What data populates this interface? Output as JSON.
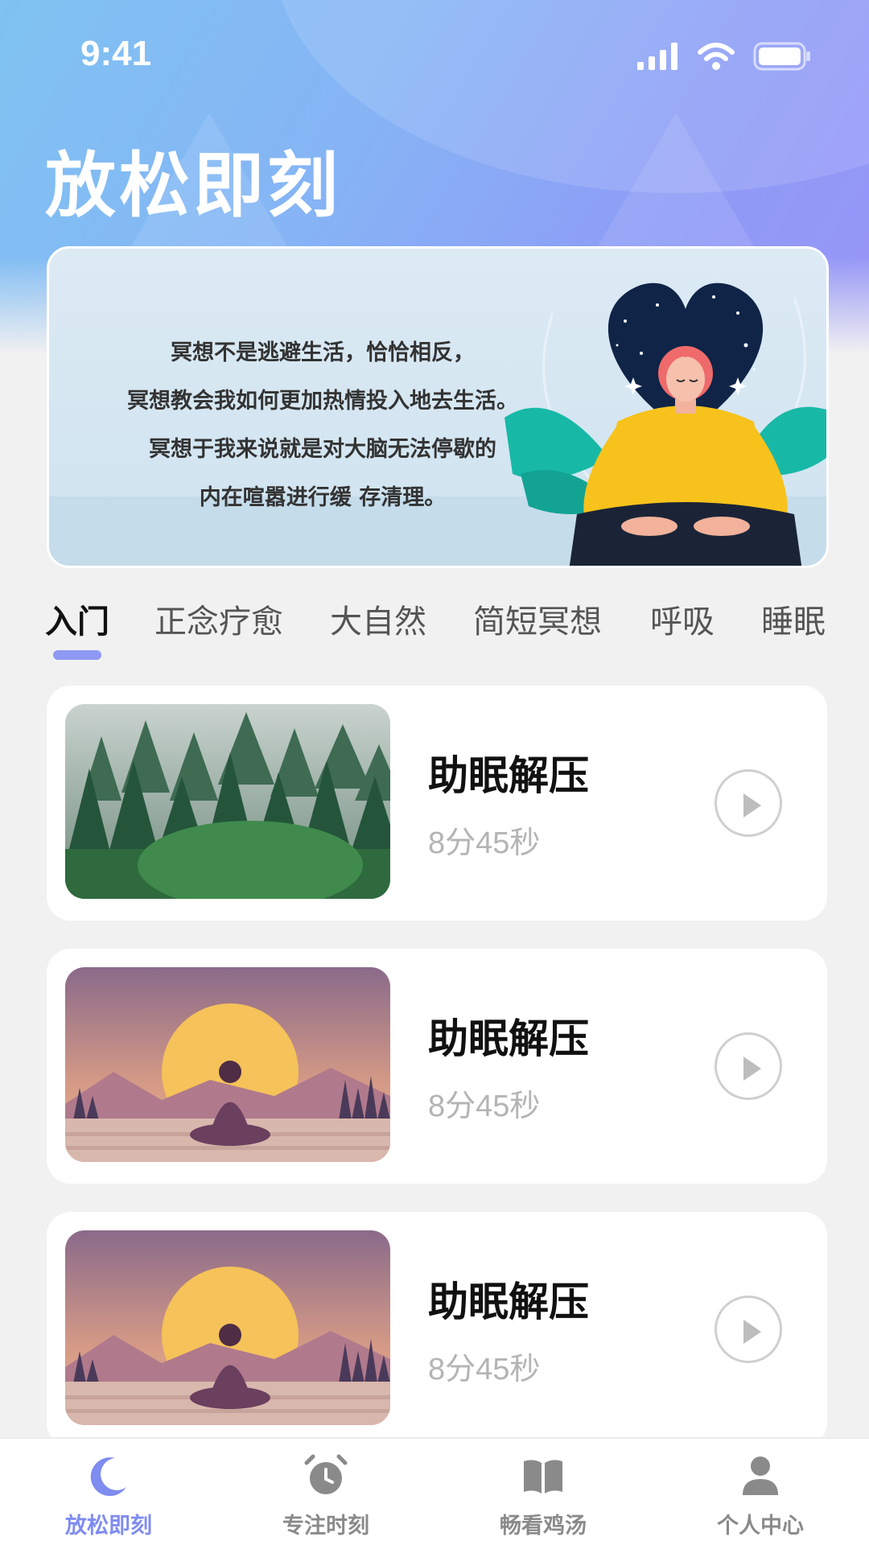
{
  "status_bar": {
    "time": "9:41"
  },
  "app_title": "放松即刻",
  "banner": {
    "quote_lines": [
      "冥想不是逃避生活，恰恰相反，",
      "冥想教会我如何更加热情投入地去生活。",
      "冥想于我来说就是对大脑无法停歇的",
      "内在喧嚣进行缓 存清理。"
    ]
  },
  "tabs": [
    {
      "label": "入门",
      "active": true
    },
    {
      "label": "正念疗愈",
      "active": false
    },
    {
      "label": "大自然",
      "active": false
    },
    {
      "label": "简短冥想",
      "active": false
    },
    {
      "label": "呼吸",
      "active": false
    },
    {
      "label": "睡眠",
      "active": false
    }
  ],
  "tracks": [
    {
      "title": "助眠解压",
      "duration": "8分45秒",
      "thumbnail": "forest"
    },
    {
      "title": "助眠解压",
      "duration": "8分45秒",
      "thumbnail": "sunset-meditation"
    },
    {
      "title": "助眠解压",
      "duration": "8分45秒",
      "thumbnail": "sunset-meditation"
    }
  ],
  "bottom_nav": [
    {
      "label": "放松即刻",
      "icon": "moon-icon",
      "active": true
    },
    {
      "label": "专注时刻",
      "icon": "alarm-clock-icon",
      "active": false
    },
    {
      "label": "畅看鸡汤",
      "icon": "book-icon",
      "active": false
    },
    {
      "label": "个人中心",
      "icon": "person-icon",
      "active": false
    }
  ],
  "colors": {
    "accent": "#7f8cf0",
    "header_gradient_start": "#7fc3f2",
    "header_gradient_end": "#9895f7",
    "inactive_nav": "#8a8a8a"
  }
}
